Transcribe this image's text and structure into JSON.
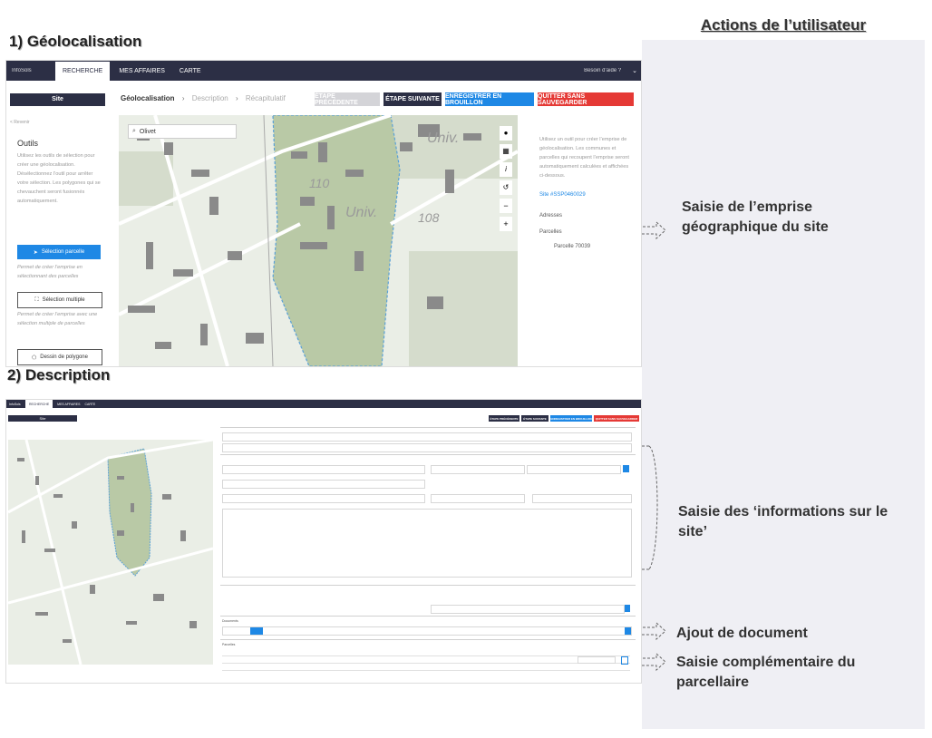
{
  "section1": {
    "title": "1) Géolocalisation"
  },
  "section2": {
    "title": "2) Description"
  },
  "right_panel": {
    "title": "Actions de l’utilisateur",
    "notes": [
      "Saisie de l’emprise géographique du site",
      "Saisie des ‘informations sur le site’",
      "Ajout de document",
      "Saisie complémentaire du parcellaire"
    ]
  },
  "screen1": {
    "nav": {
      "logo": "InfoSols",
      "items": [
        "RECHERCHE",
        "MES AFFAIRES",
        "CARTE"
      ],
      "help": "Besoin d’aide ?"
    },
    "sidebar_tab": "Site",
    "steps": [
      "Géolocalisation",
      "Description",
      "Récapitulatif"
    ],
    "buttons": {
      "prev": "ÉTAPE PRÉCÉDENTE",
      "next": "ÉTAPE SUIVANTE",
      "draft": "ENREGISTRER EN BROUILLON",
      "quit": "QUITTER SANS SAUVEGARDER"
    },
    "back": "< Revenir",
    "tools_title": "Outils",
    "tools_desc": "Utilisez les outils de sélection pour créer une géolocalisation. Désélectionnez l’outil pour arrêter votre sélection. Les polygones qui se chevauchent seront fusionnés automatiquement.",
    "tool1": "Sélection parcelle",
    "tool1_desc": "Permet de créer l’emprise en sélectionnant des parcelles",
    "tool2": "Sélection multiple",
    "tool2_desc": "Permet de créer l’emprise avec une sélection multiple de parcelles",
    "tool3": "Dessin de polygone",
    "search_value": "Olivet",
    "map_labels": [
      "Univ.",
      "110",
      "Univ.",
      "108"
    ],
    "info_text": "Utilisez un outil pour créer l’emprise de géolocalisation. Les communes et parcelles qui recoupent l’emprise seront automatiquement calculées et affichées ci-dessous.",
    "site_id": "Site #SSP0460029",
    "adresses_label": "Adresses",
    "parcelles_label": "Parcelles",
    "parcelle_item": "Parcelle 70039"
  },
  "screen2": {
    "nav": {
      "logo": "InfoSols",
      "items": [
        "RECHERCHE",
        "MES AFFAIRES",
        "CARTE"
      ]
    },
    "sidebar_tab": "Site",
    "buttons": {
      "prev": "ÉTAPE PRÉCÉDENTE",
      "next": "ÉTAPE SUIVANTE",
      "draft": "ENREGISTRER EN BROUILLON",
      "quit": "QUITTER SANS SAUVEGARDER"
    },
    "document_section": "Documents",
    "parcelles_section": "Parcelles"
  },
  "colors": {
    "nav": "#2c2f45",
    "primary": "#1e88e5",
    "quit": "#e53935",
    "map_green": "#b9c9a6",
    "map_bg": "#e9eee6"
  }
}
